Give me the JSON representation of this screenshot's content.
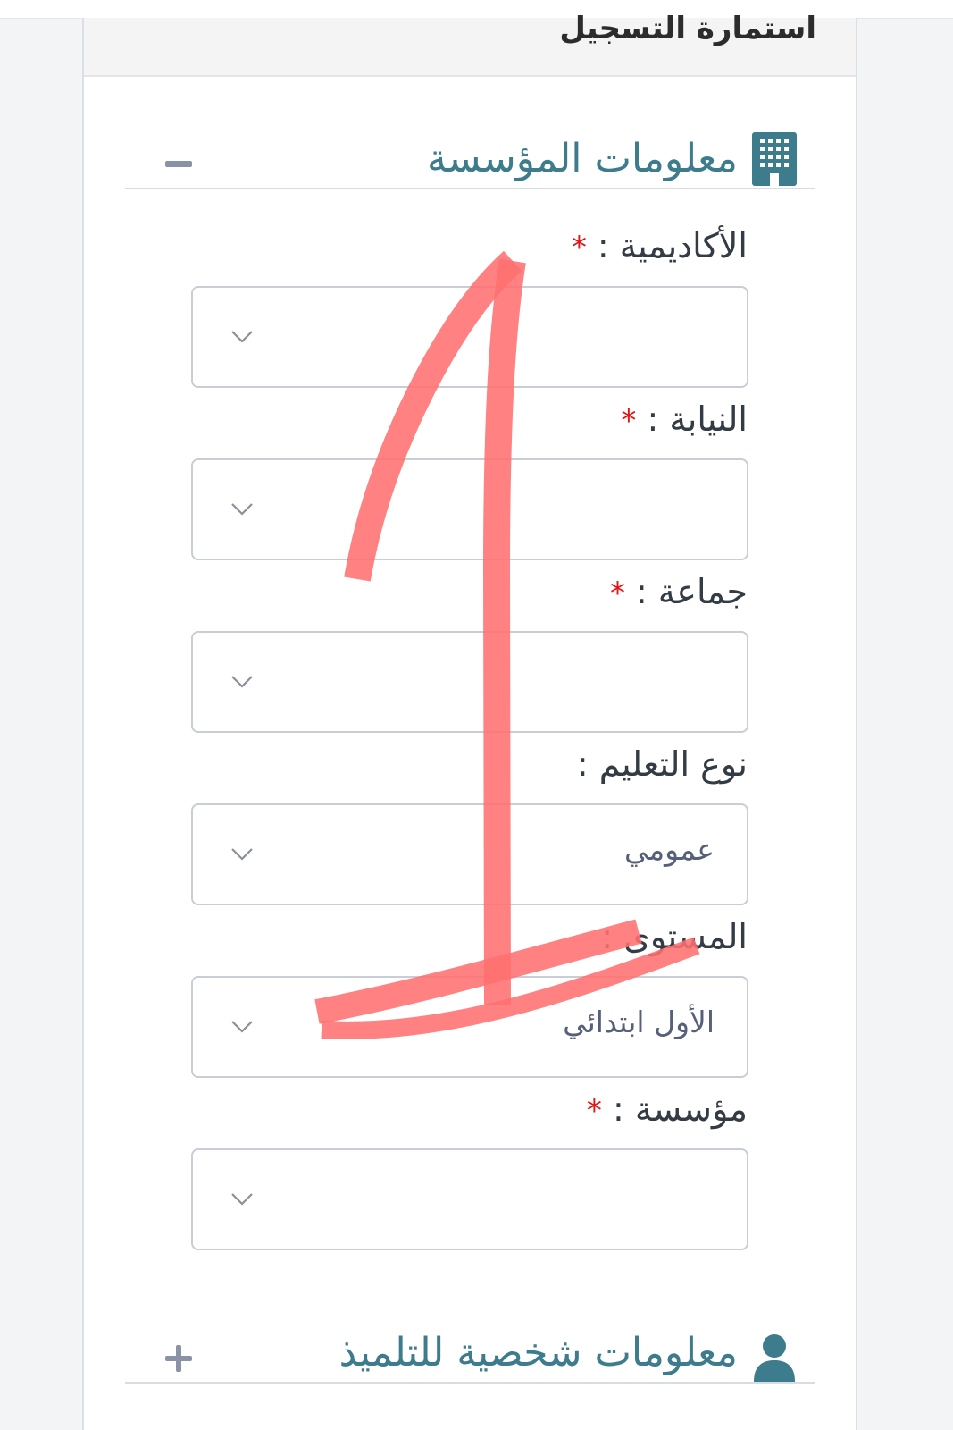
{
  "form": {
    "title": "استمارة التسجيل"
  },
  "sections": {
    "institution": {
      "title": "معلومات المؤسسة",
      "icon": "building-icon",
      "toggle_icon": "minus-icon"
    },
    "student": {
      "title": "معلومات شخصية للتلميذ",
      "icon": "user-icon",
      "toggle_icon": "plus-icon"
    }
  },
  "fields": {
    "academy": {
      "label": "الأكاديمية :",
      "required_mark": "*",
      "value": ""
    },
    "directorate": {
      "label": "النيابة :",
      "required_mark": "*",
      "value": ""
    },
    "commune": {
      "label": "جماعة :",
      "required_mark": "*",
      "value": ""
    },
    "education_type": {
      "label": "نوع التعليم :",
      "value": "عمومي"
    },
    "level": {
      "label": "المستوى :",
      "value": "الأول ابتدائي"
    },
    "institution": {
      "label": "مؤسسة :",
      "required_mark": "*",
      "value": ""
    }
  },
  "colors": {
    "section_title": "#3d7c8c",
    "required": "#e01515",
    "border": "#c9ced6",
    "annotation": "#ff6f6f"
  }
}
